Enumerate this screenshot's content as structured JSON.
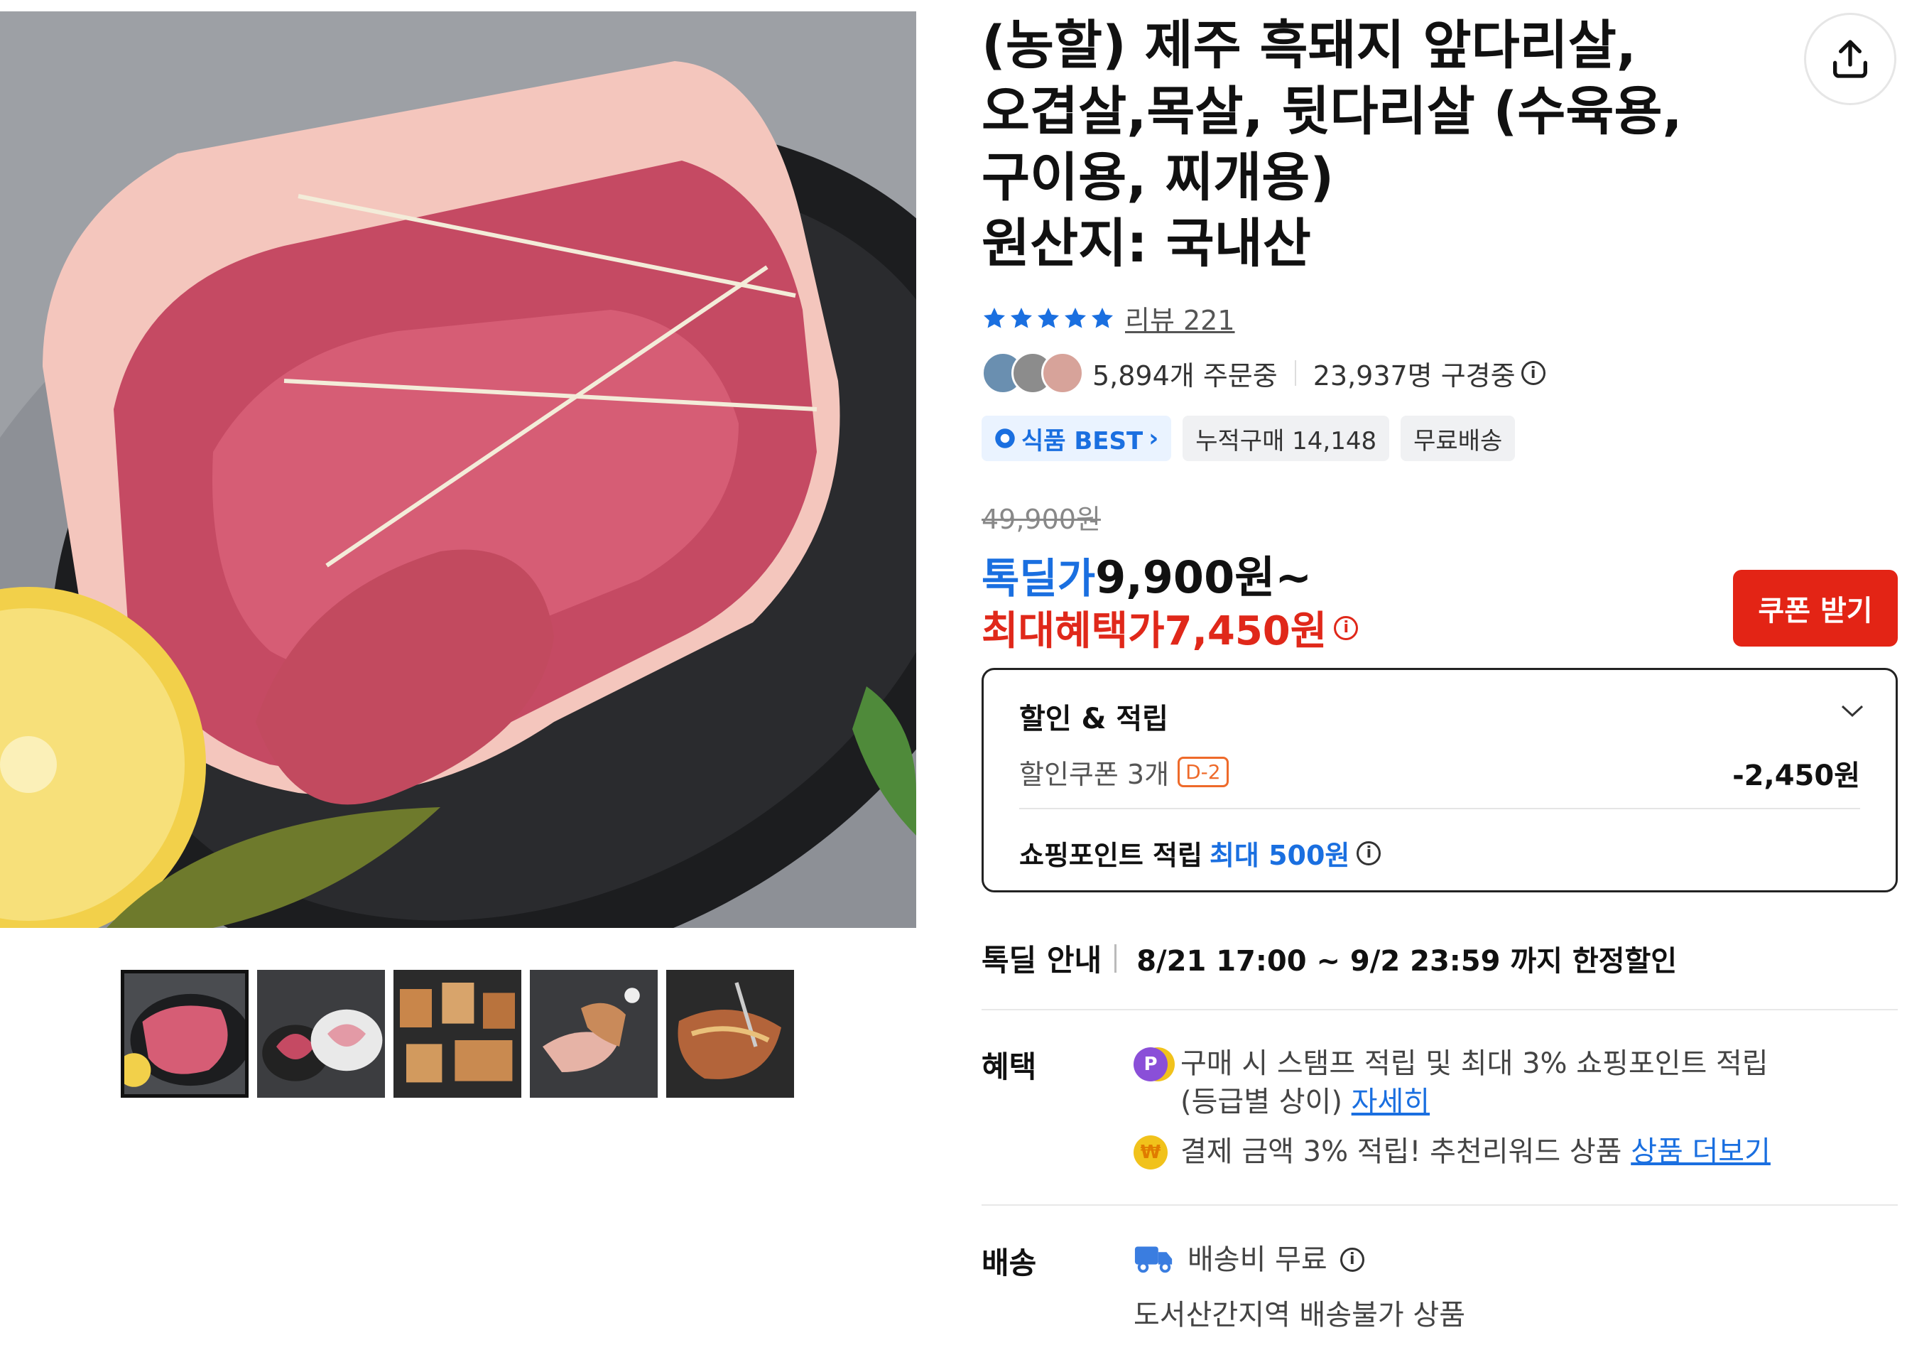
{
  "product": {
    "title_lines": [
      "(농할) 제주 흑돼지 앞다리살,",
      "오겹살,목살, 뒷다리살 (수육용,",
      "구이용, 찌개용)",
      "원산지: 국내산"
    ],
    "rating": 5,
    "review_label": "리뷰 221",
    "orders_text": "5,894개 주문중",
    "viewers_text": "23,937명 구경중",
    "badges": [
      "식품 BEST",
      "누적구매 14,148",
      "무료배송"
    ],
    "original_price": "49,900원",
    "deal_label": "톡딜가",
    "deal_price": "9,900원~",
    "max_benefit_label": "최대혜택가",
    "max_benefit_price": "7,450원",
    "coupon_button": "쿠폰 받기"
  },
  "discount_panel": {
    "title": "할인 & 적립",
    "coupon_label": "할인쿠폰 3개",
    "coupon_tag": "D-2",
    "coupon_amount": "-2,450원",
    "point_label": "쇼핑포인트 적립",
    "point_value": "최대 500원"
  },
  "tokdeal": {
    "label": "톡딜 안내",
    "period": "8/21 17:00 ~ 9/2 23:59 까지 한정할인"
  },
  "benefits": {
    "label": "혜택",
    "line1": "구매 시 스탬프 적립 및 최대 3% 쇼핑포인트 적립",
    "line1b": "(등급별 상이)",
    "line1_link": "자세히",
    "line2": "결제 금액 3% 적립! 추천리워드 상품",
    "line2_link": "상품 더보기"
  },
  "shipping": {
    "label": "배송",
    "fee": "배송비 무료",
    "note": "도서산간지역 배송불가 상품"
  },
  "colors": {
    "accent_blue": "#1a6fe0",
    "accent_red": "#e32415"
  },
  "icons": [
    "share-icon",
    "star-icon",
    "info-icon",
    "chevron-down-icon",
    "truck-icon",
    "point-p-icon",
    "reward-coin-icon"
  ]
}
